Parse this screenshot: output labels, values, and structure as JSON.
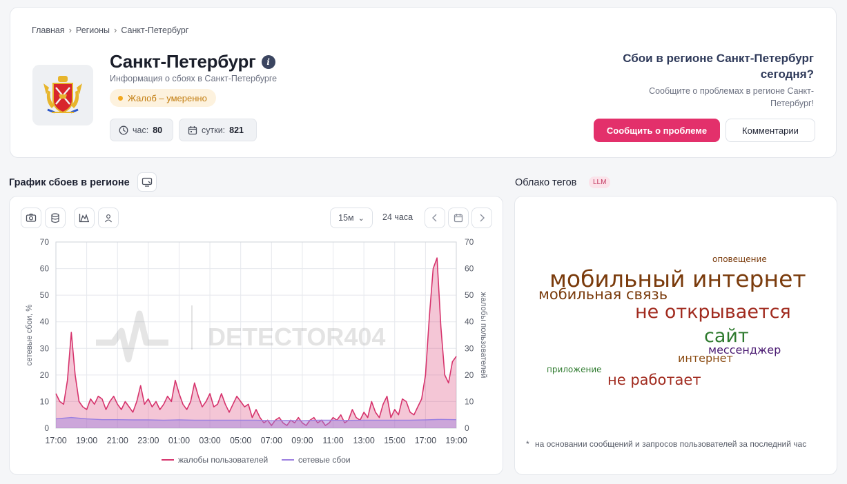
{
  "breadcrumb": {
    "home": "Главная",
    "regions": "Регионы",
    "current": "Санкт-Петербург"
  },
  "region": {
    "title": "Санкт-Петербург",
    "subtitle": "Информация о сбоях в Санкт-Петербурге",
    "status": "Жалоб – умеренно",
    "hour_label": "час:",
    "hour_value": "80",
    "day_label": "сутки:",
    "day_value": "821"
  },
  "cta": {
    "question": "Сбои в регионе Санкт-Петербург сегодня?",
    "description": "Сообщите о проблемах в регионе Санкт-Петербург!",
    "report_button": "Сообщить о проблеме",
    "comments_button": "Комментарии"
  },
  "chart_section": {
    "title": "График сбоев в регионе",
    "interval": "15м",
    "range": "24 часа",
    "watermark": "DETECTOR404"
  },
  "chart_data": {
    "type": "area",
    "ylabel_left": "сетевые сбои, %",
    "ylabel_right": "жалобы пользователей",
    "ylim": [
      0,
      70
    ],
    "yticks": [
      0,
      10,
      20,
      30,
      40,
      50,
      60,
      70
    ],
    "x_ticks": [
      "17:00",
      "19:00",
      "21:00",
      "23:00",
      "01:00",
      "03:00",
      "05:00",
      "07:00",
      "09:00",
      "11:00",
      "13:00",
      "15:00",
      "17:00",
      "19:00"
    ],
    "x_hours": [
      0,
      26
    ],
    "legend_position": "bottom",
    "grid": true,
    "series": [
      {
        "name": "жалобы пользователей",
        "color": "#d6336c",
        "points": [
          [
            0,
            13
          ],
          [
            0.25,
            10
          ],
          [
            0.5,
            9
          ],
          [
            0.75,
            18
          ],
          [
            1,
            36
          ],
          [
            1.25,
            20
          ],
          [
            1.5,
            10
          ],
          [
            1.75,
            8
          ],
          [
            2,
            7
          ],
          [
            2.25,
            11
          ],
          [
            2.5,
            9
          ],
          [
            2.75,
            12
          ],
          [
            3,
            11
          ],
          [
            3.25,
            7
          ],
          [
            3.5,
            10
          ],
          [
            3.75,
            12
          ],
          [
            4,
            9
          ],
          [
            4.25,
            7
          ],
          [
            4.5,
            10
          ],
          [
            4.75,
            8
          ],
          [
            5,
            6
          ],
          [
            5.25,
            10
          ],
          [
            5.5,
            16
          ],
          [
            5.75,
            9
          ],
          [
            6,
            11
          ],
          [
            6.25,
            8
          ],
          [
            6.5,
            10
          ],
          [
            6.75,
            7
          ],
          [
            7,
            9
          ],
          [
            7.25,
            12
          ],
          [
            7.5,
            10
          ],
          [
            7.75,
            18
          ],
          [
            8,
            13
          ],
          [
            8.25,
            9
          ],
          [
            8.5,
            7
          ],
          [
            8.75,
            10
          ],
          [
            9,
            17
          ],
          [
            9.25,
            12
          ],
          [
            9.5,
            8
          ],
          [
            9.75,
            10
          ],
          [
            10,
            13
          ],
          [
            10.25,
            8
          ],
          [
            10.5,
            9
          ],
          [
            10.75,
            13
          ],
          [
            11,
            9
          ],
          [
            11.25,
            6
          ],
          [
            11.5,
            9
          ],
          [
            11.75,
            12
          ],
          [
            12,
            10
          ],
          [
            12.25,
            8
          ],
          [
            12.5,
            9
          ],
          [
            12.75,
            4
          ],
          [
            13,
            7
          ],
          [
            13.25,
            4
          ],
          [
            13.5,
            2
          ],
          [
            13.75,
            3
          ],
          [
            14,
            1
          ],
          [
            14.25,
            3
          ],
          [
            14.5,
            4
          ],
          [
            14.75,
            2
          ],
          [
            15,
            1
          ],
          [
            15.25,
            3
          ],
          [
            15.5,
            2
          ],
          [
            15.75,
            4
          ],
          [
            16,
            2
          ],
          [
            16.25,
            1
          ],
          [
            16.5,
            3
          ],
          [
            16.75,
            4
          ],
          [
            17,
            2
          ],
          [
            17.25,
            3
          ],
          [
            17.5,
            1
          ],
          [
            17.75,
            2
          ],
          [
            18,
            4
          ],
          [
            18.25,
            3
          ],
          [
            18.5,
            5
          ],
          [
            18.75,
            2
          ],
          [
            19,
            3
          ],
          [
            19.25,
            7
          ],
          [
            19.5,
            4
          ],
          [
            19.75,
            3
          ],
          [
            20,
            6
          ],
          [
            20.25,
            4
          ],
          [
            20.5,
            10
          ],
          [
            20.75,
            6
          ],
          [
            21,
            4
          ],
          [
            21.25,
            9
          ],
          [
            21.5,
            12
          ],
          [
            21.75,
            4
          ],
          [
            22,
            7
          ],
          [
            22.25,
            5
          ],
          [
            22.5,
            11
          ],
          [
            22.75,
            10
          ],
          [
            23,
            6
          ],
          [
            23.25,
            5
          ],
          [
            23.5,
            8
          ],
          [
            23.75,
            11
          ],
          [
            24,
            20
          ],
          [
            24.25,
            42
          ],
          [
            24.5,
            60
          ],
          [
            24.75,
            64
          ],
          [
            25,
            38
          ],
          [
            25.25,
            20
          ],
          [
            25.5,
            17
          ],
          [
            25.75,
            25
          ],
          [
            26,
            27
          ]
        ]
      },
      {
        "name": "сетевые сбои",
        "color": "#9b7fe0",
        "points": [
          [
            0,
            3.5
          ],
          [
            1,
            4
          ],
          [
            2,
            3.5
          ],
          [
            3,
            3.2
          ],
          [
            4,
            3.2
          ],
          [
            5,
            3.1
          ],
          [
            6,
            3.1
          ],
          [
            7,
            3
          ],
          [
            8,
            3.1
          ],
          [
            9,
            3
          ],
          [
            10,
            3
          ],
          [
            11,
            3
          ],
          [
            12,
            3
          ],
          [
            13,
            3
          ],
          [
            14,
            2.8
          ],
          [
            15,
            2.9
          ],
          [
            16,
            2.8
          ],
          [
            17,
            3
          ],
          [
            18,
            3
          ],
          [
            19,
            2.9
          ],
          [
            20,
            3
          ],
          [
            21,
            3
          ],
          [
            22,
            3
          ],
          [
            23,
            3
          ],
          [
            24,
            3.1
          ],
          [
            25,
            3.3
          ],
          [
            26,
            3.2
          ]
        ]
      }
    ]
  },
  "cloud_section": {
    "title": "Облако тегов",
    "badge": "LLM",
    "note": "на основании сообщений и запросов пользователей за последний час",
    "tags": [
      {
        "text": "оповещение",
        "color": "#7a3b0c"
      },
      {
        "text": "мобильный интернет",
        "color": "#7a3b0c"
      },
      {
        "text": "мобильная связь",
        "color": "#7a3b0c"
      },
      {
        "text": "не открывается",
        "color": "#a12b1f"
      },
      {
        "text": "сайт",
        "color": "#2e7a2e"
      },
      {
        "text": "мессенджер",
        "color": "#4a1a72"
      },
      {
        "text": "интернет",
        "color": "#8a4a10"
      },
      {
        "text": "приложение",
        "color": "#2e7a2e"
      },
      {
        "text": "не работает",
        "color": "#a12b1f"
      }
    ]
  }
}
